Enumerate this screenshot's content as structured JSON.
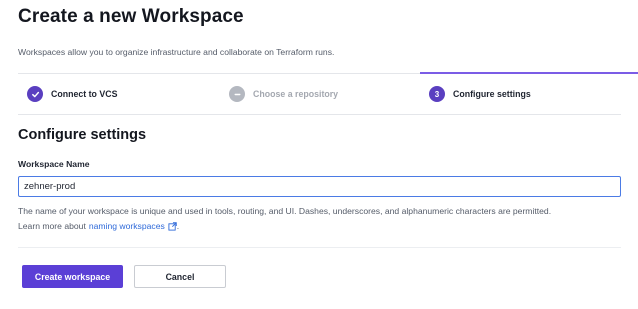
{
  "header": {
    "title": "Create a new Workspace",
    "description": "Workspaces allow you to organize infrastructure and collaborate on Terraform runs."
  },
  "steps": [
    {
      "label": "Connect to VCS",
      "status": "done",
      "icon": "check-icon",
      "marker": ""
    },
    {
      "label": "Choose a repository",
      "status": "pending",
      "icon": "dash-icon",
      "marker": ""
    },
    {
      "label": "Configure settings",
      "status": "current",
      "icon": "",
      "marker": "3"
    }
  ],
  "form": {
    "section_title": "Configure settings",
    "workspace_name_label": "Workspace Name",
    "workspace_name_value": "zehner-prod",
    "help_text": "The name of your workspace is unique and used in tools, routing, and UI. Dashes, underscores, and alphanumeric characters are permitted.",
    "learn_more_prefix": "Learn more about",
    "learn_more_link": "naming workspaces",
    "learn_more_suffix": "."
  },
  "actions": {
    "create_label": "Create workspace",
    "cancel_label": "Cancel"
  },
  "colors": {
    "accent": "#5b3fd6",
    "step_active_bar": "#7b5ce6",
    "link": "#2f6ad9",
    "input_focus_border": "#4b7be5"
  }
}
